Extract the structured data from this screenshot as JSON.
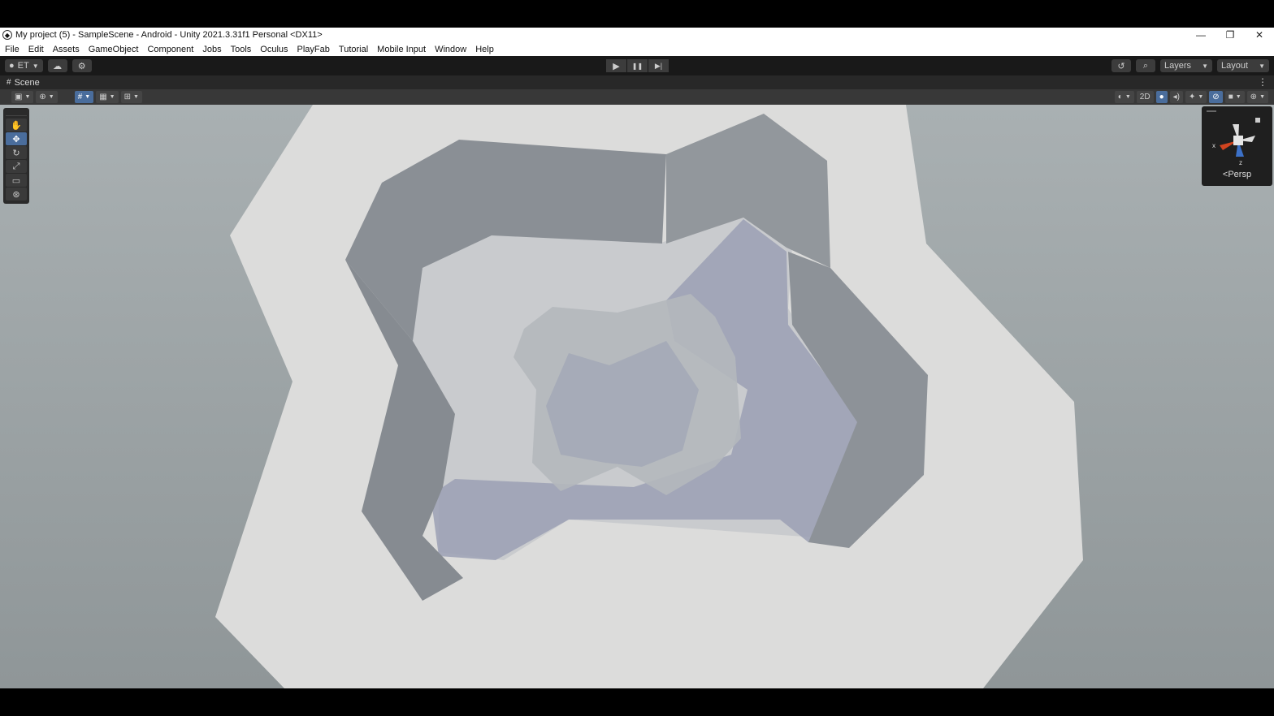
{
  "window": {
    "title": "My project (5) - SampleScene - Android - Unity 2021.3.31f1 Personal <DX11>",
    "controls": {
      "minimize": "—",
      "restore": "❐",
      "close": "✕"
    }
  },
  "menu": [
    "File",
    "Edit",
    "Assets",
    "GameObject",
    "Component",
    "Jobs",
    "Tools",
    "Oculus",
    "PlayFab",
    "Tutorial",
    "Mobile Input",
    "Window",
    "Help"
  ],
  "toolbar": {
    "account_label": "ET",
    "play_glyph": "▶",
    "pause_glyph": "❚❚",
    "step_glyph": "▶|",
    "layers_label": "Layers",
    "layout_label": "Layout"
  },
  "scene": {
    "tab_label": "Scene",
    "toggle_2d_label": "2D",
    "gizmo_label": "Persp",
    "axis_x": "x",
    "axis_z": "z"
  },
  "colors": {
    "accent": "#4a6d9c",
    "sky": "#9fa7a9",
    "floor": "#dcdcdb",
    "wall": "#8d9298",
    "shadow": "#9ba0b4",
    "axis_x": "#d0441f",
    "axis_z": "#3c71c8"
  }
}
